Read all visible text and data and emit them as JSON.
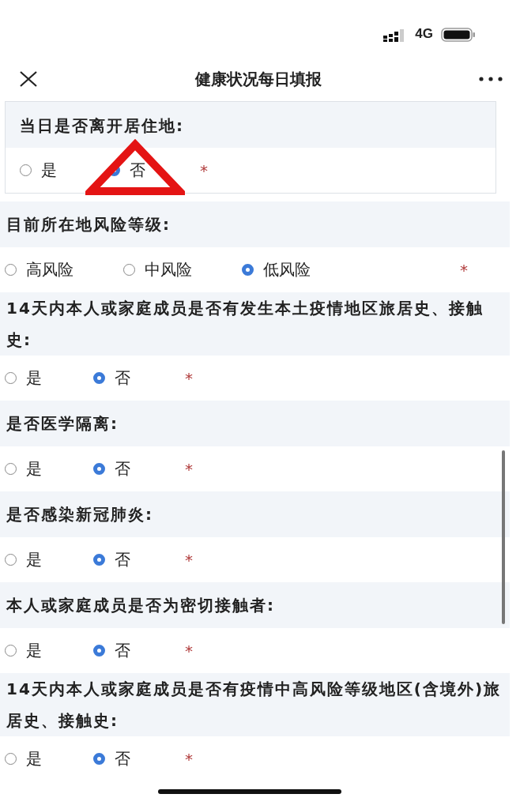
{
  "status_bar": {
    "network": "4G"
  },
  "nav_bar": {
    "title": "健康状况每日填报"
  },
  "questions": [
    {
      "kind": "boxed",
      "label": "当日是否离开居住地:",
      "required_mark": "*",
      "options": [
        {
          "label": "是",
          "selected": false
        },
        {
          "label": "否",
          "selected": true
        }
      ]
    },
    {
      "kind": "plain",
      "label": "目前所在地风险等级:",
      "required_mark": "*",
      "options": [
        {
          "label": "高风险",
          "selected": false
        },
        {
          "label": "中风险",
          "selected": false
        },
        {
          "label": "低风险",
          "selected": true
        }
      ]
    },
    {
      "kind": "plain",
      "label": "14天内本人或家庭成员是否有发生本土疫情地区旅居史、接触史:",
      "required_mark": "*",
      "options": [
        {
          "label": "是",
          "selected": false
        },
        {
          "label": "否",
          "selected": true
        }
      ]
    },
    {
      "kind": "plain",
      "label": "是否医学隔离:",
      "required_mark": "*",
      "options": [
        {
          "label": "是",
          "selected": false
        },
        {
          "label": "否",
          "selected": true
        }
      ]
    },
    {
      "kind": "plain",
      "label": "是否感染新冠肺炎:",
      "required_mark": "*",
      "options": [
        {
          "label": "是",
          "selected": false
        },
        {
          "label": "否",
          "selected": true
        }
      ]
    },
    {
      "kind": "plain",
      "label": "本人或家庭成员是否为密切接触者:",
      "required_mark": "*",
      "options": [
        {
          "label": "是",
          "selected": false
        },
        {
          "label": "否",
          "selected": true
        }
      ]
    },
    {
      "kind": "plain",
      "label": "14天内本人或家庭成员是否有疫情中高风险等级地区(含境外)旅居史、接触史:",
      "required_mark": "*",
      "options": [
        {
          "label": "是",
          "selected": false
        },
        {
          "label": "否",
          "selected": true
        }
      ]
    }
  ]
}
